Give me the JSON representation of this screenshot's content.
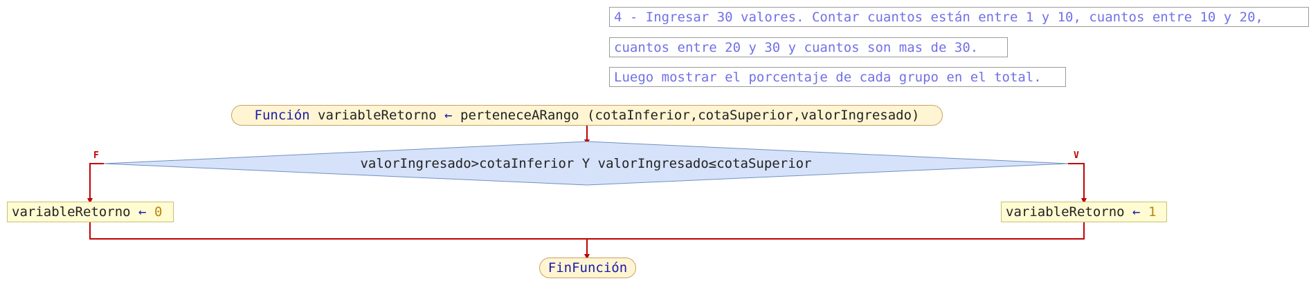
{
  "comment_lines": [
    "4 - Ingresar 30 valores. Contar cuantos están entre 1 y 10, cuantos entre 10 y 20,",
    "cuantos entre 20 y 30 y cuantos son mas de 30.",
    "Luego mostrar el porcentaje de cada grupo en el total."
  ],
  "function_header": {
    "keyword": "Función",
    "return_var": "variableRetorno",
    "arrow": "←",
    "name": "perteneceARango",
    "params": "(cotaInferior,cotaSuperior,valorIngresado)"
  },
  "decision": {
    "condition": "valorIngresado>cotaInferior Y valorIngresado≤cotaSuperior",
    "false_label": "F",
    "true_label": "V"
  },
  "assign_false": {
    "variable": "variableRetorno",
    "arrow": "←",
    "value": "0"
  },
  "assign_true": {
    "variable": "variableRetorno",
    "arrow": "←",
    "value": "1"
  },
  "end_function": {
    "label": "FinFunción"
  },
  "colors": {
    "comment_text": "#7070e8",
    "keyword": "#1a1aa8",
    "flow_line": "#c00000",
    "decision_fill": "#d6e2fa",
    "terminal_fill": "#fff5d2",
    "process_fill": "#fffbd2"
  }
}
